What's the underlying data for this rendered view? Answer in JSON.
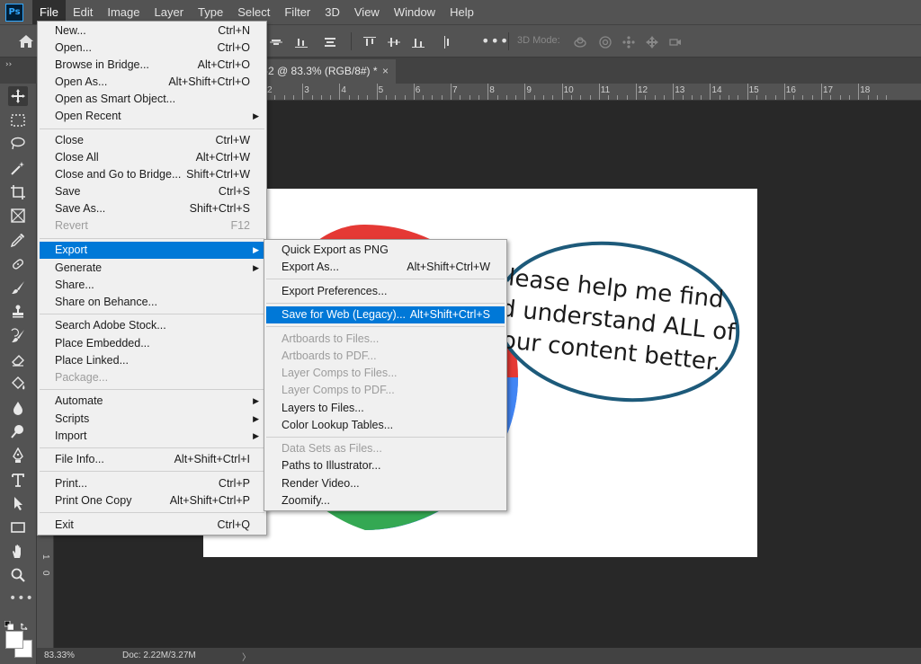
{
  "app": {
    "logo_text": "Ps"
  },
  "menubar": [
    "File",
    "Edit",
    "Image",
    "Layer",
    "Type",
    "Select",
    "Filter",
    "3D",
    "View",
    "Window",
    "Help"
  ],
  "options_bar": {
    "more": "•••",
    "mode_label": "3D Mode:"
  },
  "document_tab": {
    "title": "-2 @ 83.3% (RGB/8#) *",
    "close": "×"
  },
  "ruler_h": [
    "2",
    "3",
    "4",
    "5",
    "6",
    "7",
    "8",
    "9",
    "10",
    "11",
    "12",
    "13",
    "14",
    "15",
    "16",
    "17",
    "18"
  ],
  "ruler_v": [
    "1",
    "0"
  ],
  "canvas": {
    "bubble_lines": [
      "lease help me find",
      "d understand ALL of",
      "our content better."
    ],
    "colors": {
      "red": "#e53935",
      "blue": "#4285f4",
      "green": "#34a853",
      "bubble_outline": "#1d5a7a"
    }
  },
  "status": {
    "zoom": "83.33%",
    "doc": "Doc: 2.22M/3.27M",
    "arrow": "〉"
  },
  "file_menu": {
    "new": {
      "label": "New...",
      "shortcut": "Ctrl+N"
    },
    "open": {
      "label": "Open...",
      "shortcut": "Ctrl+O"
    },
    "browse": {
      "label": "Browse in Bridge...",
      "shortcut": "Alt+Ctrl+O"
    },
    "open_as": {
      "label": "Open As...",
      "shortcut": "Alt+Shift+Ctrl+O"
    },
    "open_smart": {
      "label": "Open as Smart Object..."
    },
    "open_recent": {
      "label": "Open Recent"
    },
    "close": {
      "label": "Close",
      "shortcut": "Ctrl+W"
    },
    "close_all": {
      "label": "Close All",
      "shortcut": "Alt+Ctrl+W"
    },
    "close_bridge": {
      "label": "Close and Go to Bridge...",
      "shortcut": "Shift+Ctrl+W"
    },
    "save": {
      "label": "Save",
      "shortcut": "Ctrl+S"
    },
    "save_as": {
      "label": "Save As...",
      "shortcut": "Shift+Ctrl+S"
    },
    "revert": {
      "label": "Revert",
      "shortcut": "F12"
    },
    "export": {
      "label": "Export"
    },
    "generate": {
      "label": "Generate"
    },
    "share": {
      "label": "Share..."
    },
    "share_behance": {
      "label": "Share on Behance..."
    },
    "search_stock": {
      "label": "Search Adobe Stock..."
    },
    "place_embedded": {
      "label": "Place Embedded..."
    },
    "place_linked": {
      "label": "Place Linked..."
    },
    "package": {
      "label": "Package..."
    },
    "automate": {
      "label": "Automate"
    },
    "scripts": {
      "label": "Scripts"
    },
    "import": {
      "label": "Import"
    },
    "file_info": {
      "label": "File Info...",
      "shortcut": "Alt+Shift+Ctrl+I"
    },
    "print": {
      "label": "Print...",
      "shortcut": "Ctrl+P"
    },
    "print_one": {
      "label": "Print One Copy",
      "shortcut": "Alt+Shift+Ctrl+P"
    },
    "exit": {
      "label": "Exit",
      "shortcut": "Ctrl+Q"
    }
  },
  "export_menu": {
    "quick_export": {
      "label": "Quick Export as PNG"
    },
    "export_as": {
      "label": "Export As...",
      "shortcut": "Alt+Shift+Ctrl+W"
    },
    "export_prefs": {
      "label": "Export Preferences..."
    },
    "save_for_web": {
      "label": "Save for Web (Legacy)...",
      "shortcut": "Alt+Shift+Ctrl+S"
    },
    "artboards_files": {
      "label": "Artboards to Files..."
    },
    "artboards_pdf": {
      "label": "Artboards to PDF..."
    },
    "layer_comps_files": {
      "label": "Layer Comps to Files..."
    },
    "layer_comps_pdf": {
      "label": "Layer Comps to PDF..."
    },
    "layers_files": {
      "label": "Layers to Files..."
    },
    "color_lookup": {
      "label": "Color Lookup Tables..."
    },
    "data_sets": {
      "label": "Data Sets as Files..."
    },
    "paths_illustrator": {
      "label": "Paths to Illustrator..."
    },
    "render_video": {
      "label": "Render Video..."
    },
    "zoomify": {
      "label": "Zoomify..."
    }
  }
}
